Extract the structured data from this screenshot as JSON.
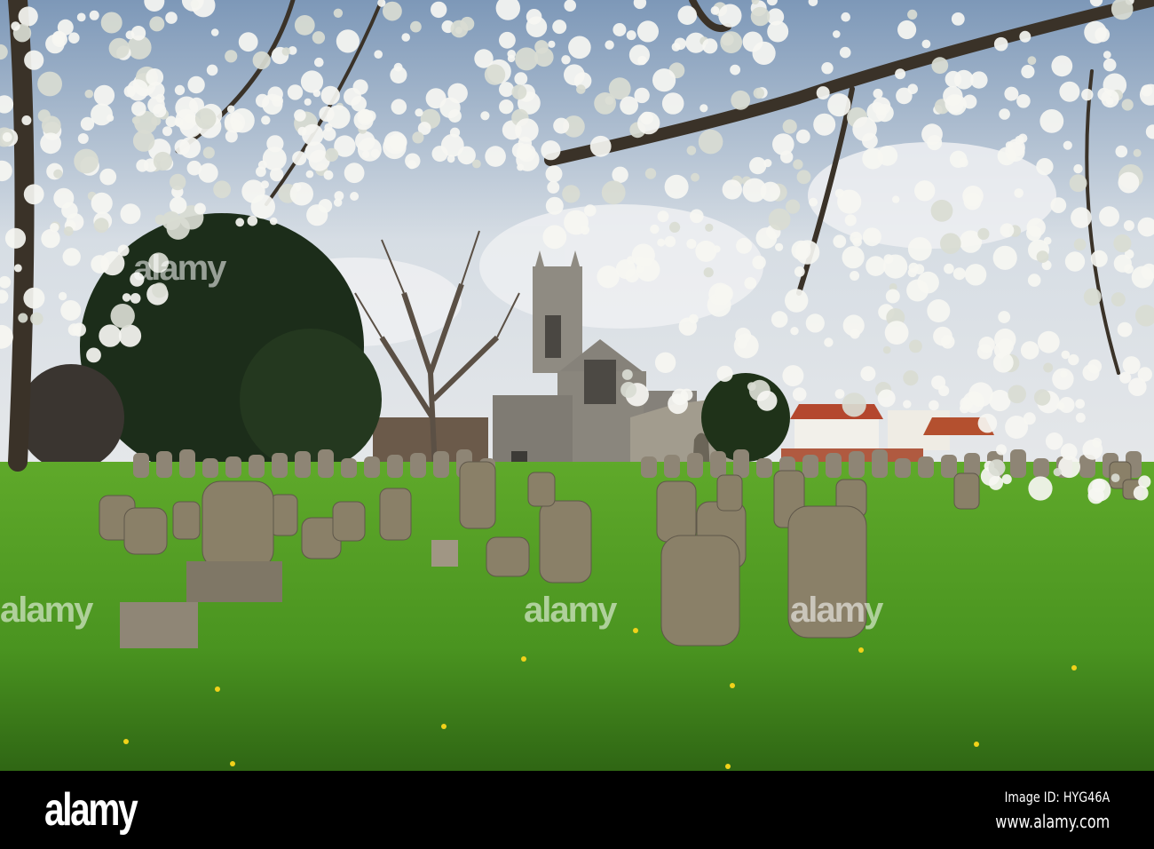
{
  "photo": {
    "subject": "churchyard",
    "watermark_text": "alamy",
    "colors": {
      "sky": "#c9d3de",
      "grass": "#4f9a22",
      "blossom": "#f4f4f0",
      "stone": "#8c8370",
      "church": "#8e8a80"
    }
  },
  "footer": {
    "logo": "alamy",
    "image_id": "Image ID: HYG46A",
    "website": "www.alamy.com"
  }
}
